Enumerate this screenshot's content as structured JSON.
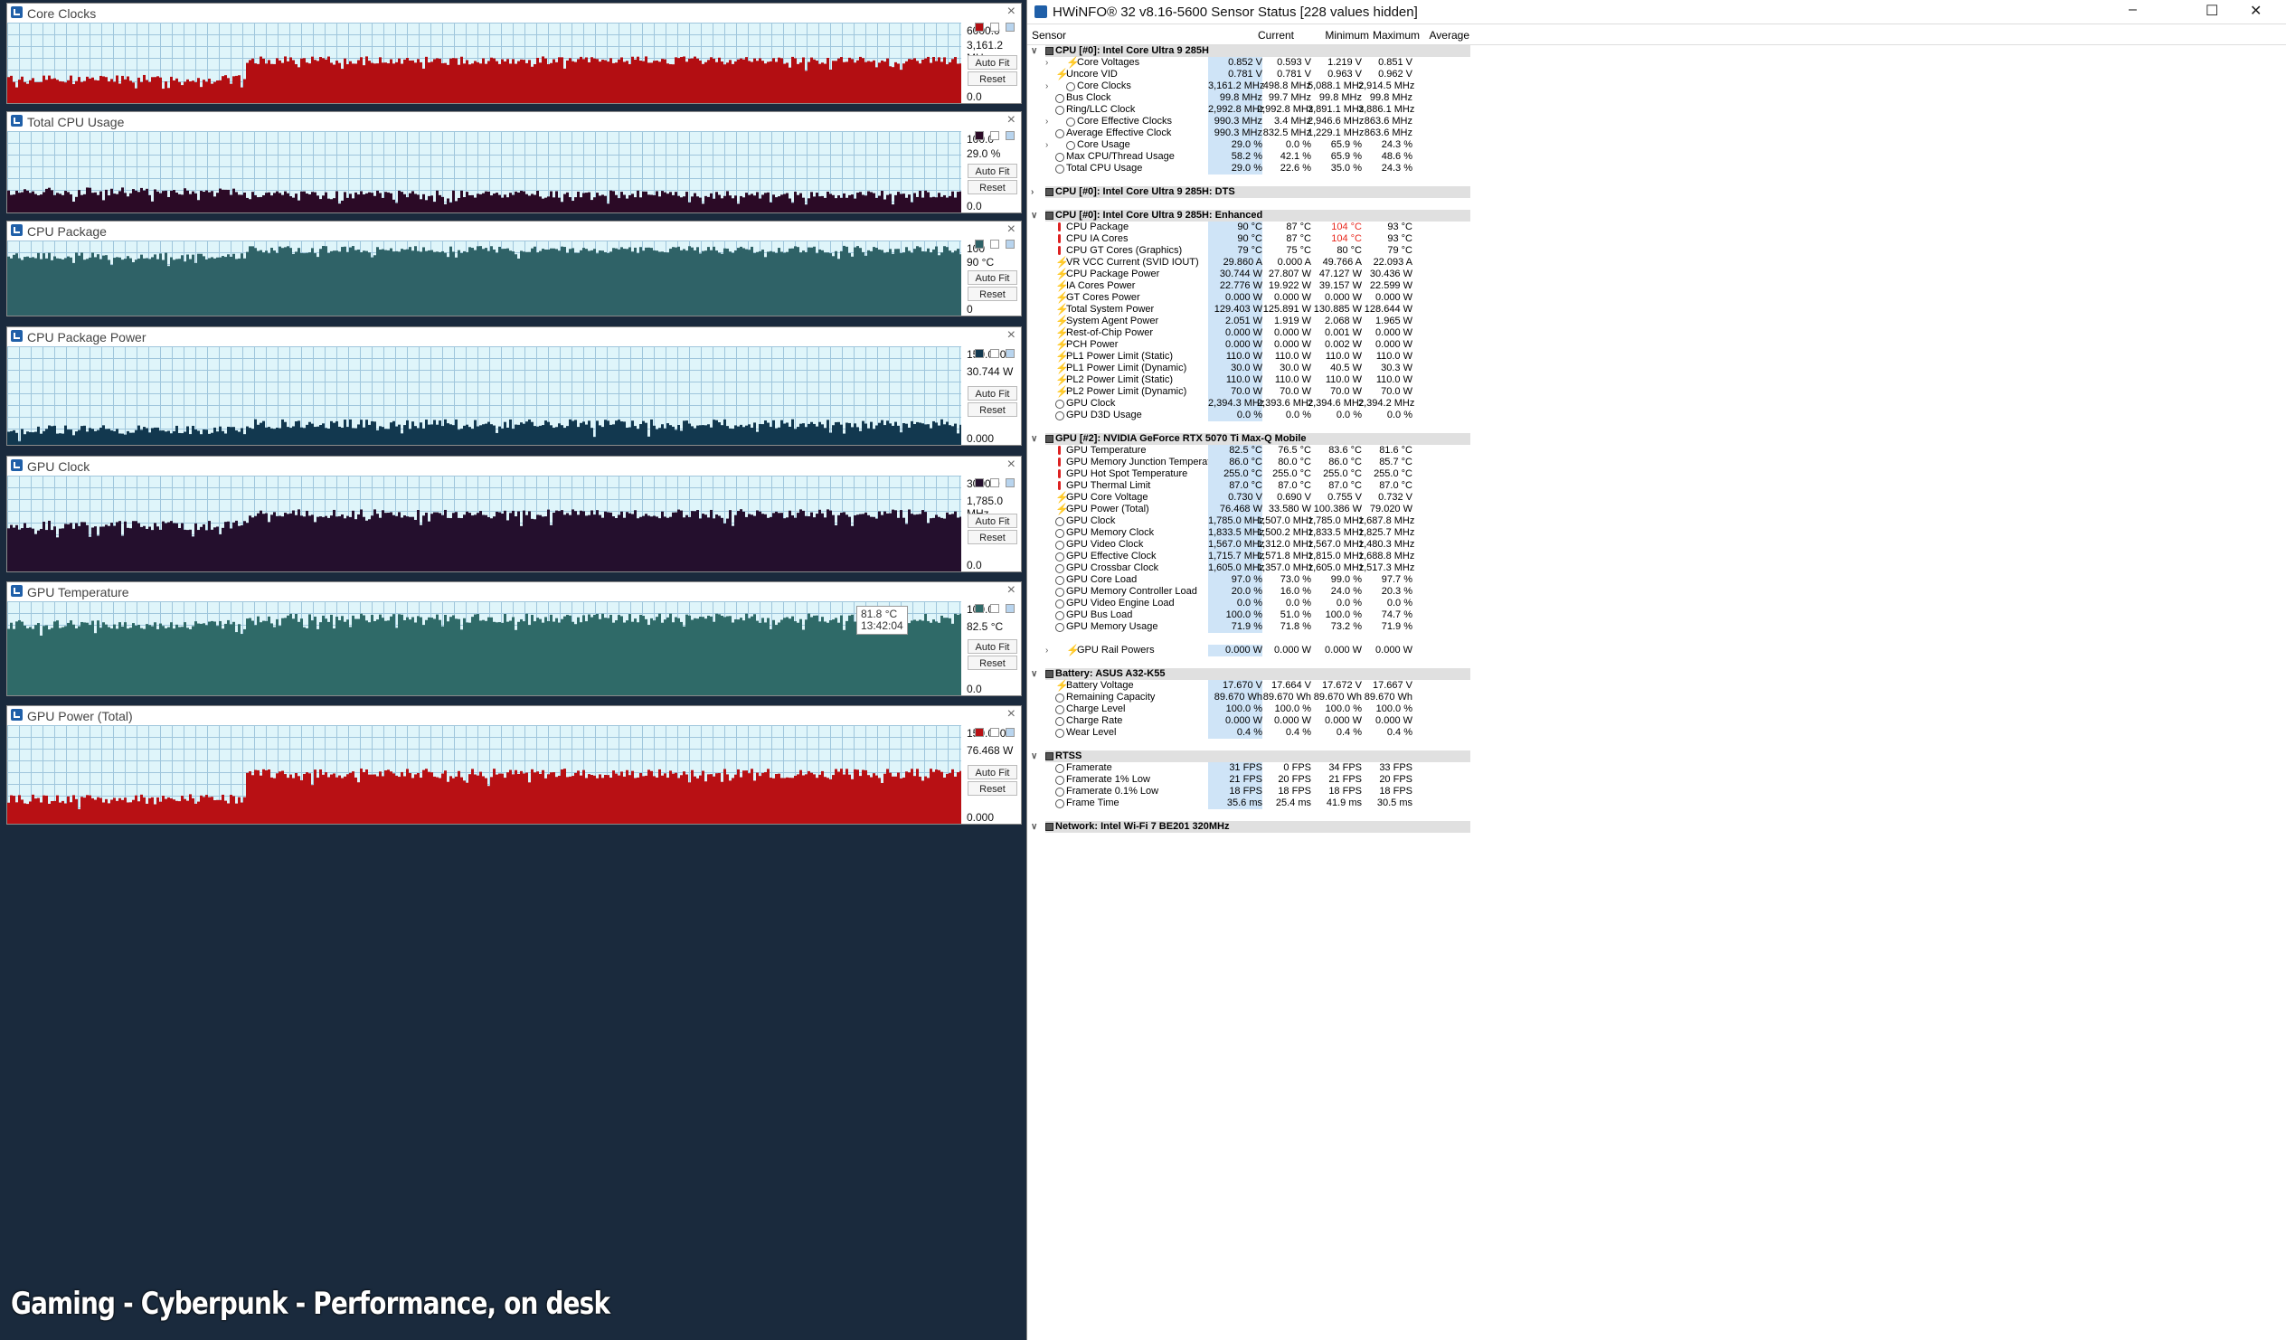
{
  "caption": "Gaming - Cyberpunk - Performance, on desk",
  "graph_buttons": {
    "autofit": "Auto Fit",
    "reset": "Reset"
  },
  "tooltip": {
    "value": "81.8 °C",
    "time": "13:42:04"
  },
  "graphs": [
    {
      "title": "Core Clocks",
      "max": "6000.0",
      "current": "3,161.2 MHz",
      "min": "0.0",
      "color": "#b30e12",
      "before": 0.3,
      "after": 0.53
    },
    {
      "title": "Total CPU Usage",
      "max": "100.0",
      "current": "29.0 %",
      "min": "0.0",
      "color": "#2b0a26",
      "before": 0.26,
      "after": 0.22
    },
    {
      "title": "CPU Package",
      "max": "100",
      "current": "90 °C",
      "min": "0",
      "color": "#2f6267",
      "before": 0.79,
      "after": 0.88
    },
    {
      "title": "CPU Package Power",
      "max": "150.000",
      "current": "30.744 W",
      "min": "0.000",
      "color": "#12384f",
      "before": 0.15,
      "after": 0.21
    },
    {
      "title": "GPU Clock",
      "max": "3000.0",
      "current": "1,785.0 MHz",
      "min": "0.0",
      "color": "#240f2d",
      "before": 0.48,
      "after": 0.6
    },
    {
      "title": "GPU Temperature",
      "max": "100.0",
      "current": "82.5 °C",
      "min": "0.0",
      "color": "#2f6a68",
      "before": 0.75,
      "after": 0.82
    },
    {
      "title": "GPU Power (Total)",
      "max": "150.000",
      "current": "76.468 W",
      "min": "0.000",
      "color": "#b81014",
      "before": 0.25,
      "after": 0.51
    }
  ],
  "hwinfo": {
    "title": "HWiNFO® 32 v8.16-5600 Sensor Status [228 values hidden]",
    "columns": [
      "Sensor",
      "Current",
      "Minimum",
      "Maximum",
      "Average"
    ],
    "rows": [
      {
        "t": "g",
        "name": "CPU [#0]: Intel Core Ultra 9 285H",
        "open": true
      },
      {
        "t": "s",
        "i": "volt",
        "sub": true,
        "name": "Core Voltages",
        "v": [
          "0.852 V",
          "0.593 V",
          "1.219 V",
          "0.851 V"
        ]
      },
      {
        "t": "s",
        "i": "volt",
        "name": "Uncore VID",
        "v": [
          "0.781 V",
          "0.781 V",
          "0.963 V",
          "0.962 V"
        ]
      },
      {
        "t": "s",
        "i": "clock",
        "sub": true,
        "name": "Core Clocks",
        "v": [
          "3,161.2 MHz",
          "498.8 MHz",
          "5,088.1 MHz",
          "2,914.5 MHz"
        ]
      },
      {
        "t": "s",
        "i": "clock",
        "name": "Bus Clock",
        "v": [
          "99.8 MHz",
          "99.7 MHz",
          "99.8 MHz",
          "99.8 MHz"
        ]
      },
      {
        "t": "s",
        "i": "clock",
        "name": "Ring/LLC Clock",
        "v": [
          "2,992.8 MHz",
          "2,992.8 MHz",
          "3,891.1 MHz",
          "3,886.1 MHz"
        ]
      },
      {
        "t": "s",
        "i": "clock",
        "sub": true,
        "name": "Core Effective Clocks",
        "v": [
          "990.3 MHz",
          "3.4 MHz",
          "2,946.6 MHz",
          "863.6 MHz"
        ]
      },
      {
        "t": "s",
        "i": "clock",
        "name": "Average Effective Clock",
        "v": [
          "990.3 MHz",
          "832.5 MHz",
          "1,229.1 MHz",
          "863.6 MHz"
        ]
      },
      {
        "t": "s",
        "i": "clock",
        "sub": true,
        "name": "Core Usage",
        "v": [
          "29.0 %",
          "0.0 %",
          "65.9 %",
          "24.3 %"
        ]
      },
      {
        "t": "s",
        "i": "clock",
        "name": "Max CPU/Thread Usage",
        "v": [
          "58.2 %",
          "42.1 %",
          "65.9 %",
          "48.6 %"
        ]
      },
      {
        "t": "s",
        "i": "clock",
        "name": "Total CPU Usage",
        "v": [
          "29.0 %",
          "22.6 %",
          "35.0 %",
          "24.3 %"
        ]
      },
      {
        "t": "e"
      },
      {
        "t": "g",
        "name": "CPU [#0]: Intel Core Ultra 9 285H: DTS",
        "open": false
      },
      {
        "t": "e"
      },
      {
        "t": "g",
        "name": "CPU [#0]: Intel Core Ultra 9 285H: Enhanced",
        "open": true
      },
      {
        "t": "s",
        "i": "temp",
        "name": "CPU Package",
        "v": [
          "90 °C",
          "87 °C",
          "104 °C",
          "93 °C"
        ],
        "r": [
          2
        ]
      },
      {
        "t": "s",
        "i": "temp",
        "name": "CPU IA Cores",
        "v": [
          "90 °C",
          "87 °C",
          "104 °C",
          "93 °C"
        ],
        "r": [
          2
        ]
      },
      {
        "t": "s",
        "i": "temp",
        "name": "CPU GT Cores (Graphics)",
        "v": [
          "79 °C",
          "75 °C",
          "80 °C",
          "79 °C"
        ]
      },
      {
        "t": "s",
        "i": "volt",
        "name": "VR VCC Current (SVID IOUT)",
        "v": [
          "29.860 A",
          "0.000 A",
          "49.766 A",
          "22.093 A"
        ]
      },
      {
        "t": "s",
        "i": "volt",
        "name": "CPU Package Power",
        "v": [
          "30.744 W",
          "27.807 W",
          "47.127 W",
          "30.436 W"
        ]
      },
      {
        "t": "s",
        "i": "volt",
        "name": "IA Cores Power",
        "v": [
          "22.776 W",
          "19.922 W",
          "39.157 W",
          "22.599 W"
        ]
      },
      {
        "t": "s",
        "i": "volt",
        "name": "GT Cores Power",
        "v": [
          "0.000 W",
          "0.000 W",
          "0.000 W",
          "0.000 W"
        ]
      },
      {
        "t": "s",
        "i": "volt",
        "name": "Total System Power",
        "v": [
          "129.403 W",
          "125.891 W",
          "130.885 W",
          "128.644 W"
        ]
      },
      {
        "t": "s",
        "i": "volt",
        "name": "System Agent Power",
        "v": [
          "2.051 W",
          "1.919 W",
          "2.068 W",
          "1.965 W"
        ]
      },
      {
        "t": "s",
        "i": "volt",
        "name": "Rest-of-Chip Power",
        "v": [
          "0.000 W",
          "0.000 W",
          "0.001 W",
          "0.000 W"
        ]
      },
      {
        "t": "s",
        "i": "volt",
        "name": "PCH Power",
        "v": [
          "0.000 W",
          "0.000 W",
          "0.002 W",
          "0.000 W"
        ]
      },
      {
        "t": "s",
        "i": "volt",
        "name": "PL1 Power Limit (Static)",
        "v": [
          "110.0 W",
          "110.0 W",
          "110.0 W",
          "110.0 W"
        ]
      },
      {
        "t": "s",
        "i": "volt",
        "name": "PL1 Power Limit (Dynamic)",
        "v": [
          "30.0 W",
          "30.0 W",
          "40.5 W",
          "30.3 W"
        ]
      },
      {
        "t": "s",
        "i": "volt",
        "name": "PL2 Power Limit (Static)",
        "v": [
          "110.0 W",
          "110.0 W",
          "110.0 W",
          "110.0 W"
        ]
      },
      {
        "t": "s",
        "i": "volt",
        "name": "PL2 Power Limit (Dynamic)",
        "v": [
          "70.0 W",
          "70.0 W",
          "70.0 W",
          "70.0 W"
        ]
      },
      {
        "t": "s",
        "i": "clock",
        "name": "GPU Clock",
        "v": [
          "2,394.3 MHz",
          "2,393.6 MHz",
          "2,394.6 MHz",
          "2,394.2 MHz"
        ]
      },
      {
        "t": "s",
        "i": "clock",
        "name": "GPU D3D Usage",
        "v": [
          "0.0 %",
          "0.0 %",
          "0.0 %",
          "0.0 %"
        ]
      },
      {
        "t": "e"
      },
      {
        "t": "g",
        "name": "GPU [#2]: NVIDIA  GeForce RTX 5070 Ti Max-Q Mobile",
        "open": true
      },
      {
        "t": "s",
        "i": "temp",
        "name": "GPU Temperature",
        "v": [
          "82.5 °C",
          "76.5 °C",
          "83.6 °C",
          "81.6 °C"
        ]
      },
      {
        "t": "s",
        "i": "temp",
        "name": "GPU Memory Junction Temperature",
        "v": [
          "86.0 °C",
          "80.0 °C",
          "86.0 °C",
          "85.7 °C"
        ]
      },
      {
        "t": "s",
        "i": "temp",
        "name": "GPU Hot Spot Temperature",
        "v": [
          "255.0 °C",
          "255.0 °C",
          "255.0 °C",
          "255.0 °C"
        ]
      },
      {
        "t": "s",
        "i": "temp",
        "name": "GPU Thermal Limit",
        "v": [
          "87.0 °C",
          "87.0 °C",
          "87.0 °C",
          "87.0 °C"
        ]
      },
      {
        "t": "s",
        "i": "volt",
        "name": "GPU Core Voltage",
        "v": [
          "0.730 V",
          "0.690 V",
          "0.755 V",
          "0.732 V"
        ]
      },
      {
        "t": "s",
        "i": "volt",
        "name": "GPU Power (Total)",
        "v": [
          "76.468 W",
          "33.580 W",
          "100.386 W",
          "79.020 W"
        ]
      },
      {
        "t": "s",
        "i": "clock",
        "name": "GPU Clock",
        "v": [
          "1,785.0 MHz",
          "1,507.0 MHz",
          "1,785.0 MHz",
          "1,687.8 MHz"
        ]
      },
      {
        "t": "s",
        "i": "clock",
        "name": "GPU Memory Clock",
        "v": [
          "1,833.5 MHz",
          "1,500.2 MHz",
          "1,833.5 MHz",
          "1,825.7 MHz"
        ]
      },
      {
        "t": "s",
        "i": "clock",
        "name": "GPU Video Clock",
        "v": [
          "1,567.0 MHz",
          "1,312.0 MHz",
          "1,567.0 MHz",
          "1,480.3 MHz"
        ]
      },
      {
        "t": "s",
        "i": "clock",
        "name": "GPU Effective Clock",
        "v": [
          "1,715.7 MHz",
          "1,571.8 MHz",
          "1,815.0 MHz",
          "1,688.8 MHz"
        ]
      },
      {
        "t": "s",
        "i": "clock",
        "name": "GPU Crossbar Clock",
        "v": [
          "1,605.0 MHz",
          "1,357.0 MHz",
          "1,605.0 MHz",
          "1,517.3 MHz"
        ]
      },
      {
        "t": "s",
        "i": "clock",
        "name": "GPU Core Load",
        "v": [
          "97.0 %",
          "73.0 %",
          "99.0 %",
          "97.7 %"
        ]
      },
      {
        "t": "s",
        "i": "clock",
        "name": "GPU Memory Controller Load",
        "v": [
          "20.0 %",
          "16.0 %",
          "24.0 %",
          "20.3 %"
        ]
      },
      {
        "t": "s",
        "i": "clock",
        "name": "GPU Video Engine Load",
        "v": [
          "0.0 %",
          "0.0 %",
          "0.0 %",
          "0.0 %"
        ]
      },
      {
        "t": "s",
        "i": "clock",
        "name": "GPU Bus Load",
        "v": [
          "100.0 %",
          "51.0 %",
          "100.0 %",
          "74.7 %"
        ]
      },
      {
        "t": "s",
        "i": "clock",
        "name": "GPU Memory Usage",
        "v": [
          "71.9 %",
          "71.8 %",
          "73.2 %",
          "71.9 %"
        ]
      },
      {
        "t": "e"
      },
      {
        "t": "s",
        "i": "volt",
        "sub": true,
        "name": "GPU Rail Powers",
        "v": [
          "0.000 W",
          "0.000 W",
          "0.000 W",
          "0.000 W"
        ]
      },
      {
        "t": "e"
      },
      {
        "t": "g",
        "name": "Battery: ASUS  A32-K55",
        "open": true
      },
      {
        "t": "s",
        "i": "volt",
        "name": "Battery Voltage",
        "v": [
          "17.670 V",
          "17.664 V",
          "17.672 V",
          "17.667 V"
        ]
      },
      {
        "t": "s",
        "i": "clock",
        "name": "Remaining Capacity",
        "v": [
          "89.670 Wh",
          "89.670 Wh",
          "89.670 Wh",
          "89.670 Wh"
        ]
      },
      {
        "t": "s",
        "i": "clock",
        "name": "Charge Level",
        "v": [
          "100.0 %",
          "100.0 %",
          "100.0 %",
          "100.0 %"
        ]
      },
      {
        "t": "s",
        "i": "clock",
        "name": "Charge Rate",
        "v": [
          "0.000 W",
          "0.000 W",
          "0.000 W",
          "0.000 W"
        ]
      },
      {
        "t": "s",
        "i": "clock",
        "name": "Wear Level",
        "v": [
          "0.4 %",
          "0.4 %",
          "0.4 %",
          "0.4 %"
        ]
      },
      {
        "t": "e"
      },
      {
        "t": "g",
        "name": "RTSS",
        "open": true
      },
      {
        "t": "s",
        "i": "clock",
        "name": "Framerate",
        "v": [
          "31 FPS",
          "0 FPS",
          "34 FPS",
          "33 FPS"
        ]
      },
      {
        "t": "s",
        "i": "clock",
        "name": "Framerate 1% Low",
        "v": [
          "21 FPS",
          "20 FPS",
          "21 FPS",
          "20 FPS"
        ]
      },
      {
        "t": "s",
        "i": "clock",
        "name": "Framerate 0.1% Low",
        "v": [
          "18 FPS",
          "18 FPS",
          "18 FPS",
          "18 FPS"
        ]
      },
      {
        "t": "s",
        "i": "clock",
        "name": "Frame Time",
        "v": [
          "35.6 ms",
          "25.4 ms",
          "41.9 ms",
          "30.5 ms"
        ]
      },
      {
        "t": "e"
      },
      {
        "t": "g",
        "name": "Network: Intel Wi-Fi 7 BE201 320MHz",
        "open": true
      }
    ]
  }
}
